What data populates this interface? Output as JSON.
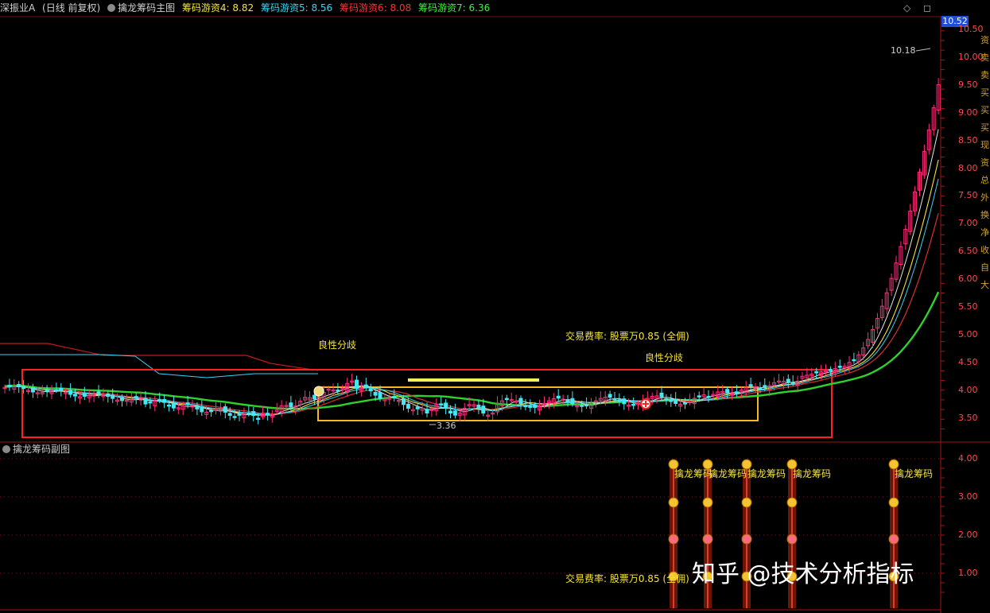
{
  "header": {
    "stock_name": "深振业A",
    "period": "(日线 前复权)",
    "indicator": "擒龙筹码主图",
    "legend": [
      {
        "label": "筹码游资4: 8.82",
        "color": "#f5e43a"
      },
      {
        "label": "筹码游资5: 8.56",
        "color": "#35d6f0"
      },
      {
        "label": "筹码游资6: 8.08",
        "color": "#ff3030"
      },
      {
        "label": "筹码游资7: 6.36",
        "color": "#3cf23c"
      }
    ],
    "top_icons": "◇ ◻"
  },
  "current_price": "10.52",
  "main_axis": [
    "10.50",
    "10.00",
    "9.50",
    "9.00",
    "8.50",
    "8.00",
    "7.50",
    "7.00",
    "6.50",
    "6.00",
    "5.50",
    "5.00",
    "4.50",
    "4.00",
    "3.50"
  ],
  "sub_axis": [
    "4.00",
    "3.00",
    "2.00",
    "1.00"
  ],
  "annotations": {
    "high": "10.18",
    "low": "3.36",
    "divergence_1": "良性分歧",
    "divergence_2": "良性分歧",
    "fee_1": "交易费率: 股票万0.85 (全佣)",
    "fee_2": "交易费率: 股票万0.85 (全佣)"
  },
  "sub_chart": {
    "title": "擒龙筹码副图",
    "signal_label": "擒龙筹码"
  },
  "right_side_tags": [
    "资",
    "卖",
    "卖",
    "买",
    "买",
    "买",
    "现",
    "资",
    "总",
    "外",
    "换",
    "净",
    "收",
    "自",
    "大"
  ],
  "watermark": "知乎 @技术分析指标",
  "colors": {
    "up": "#ff2d7a",
    "down": "#44e8f5",
    "ma_green": "#2ed12e",
    "box_red": "#ff2020",
    "box_yellow": "#f5b820",
    "axis_red": "#ff4a4a"
  }
}
